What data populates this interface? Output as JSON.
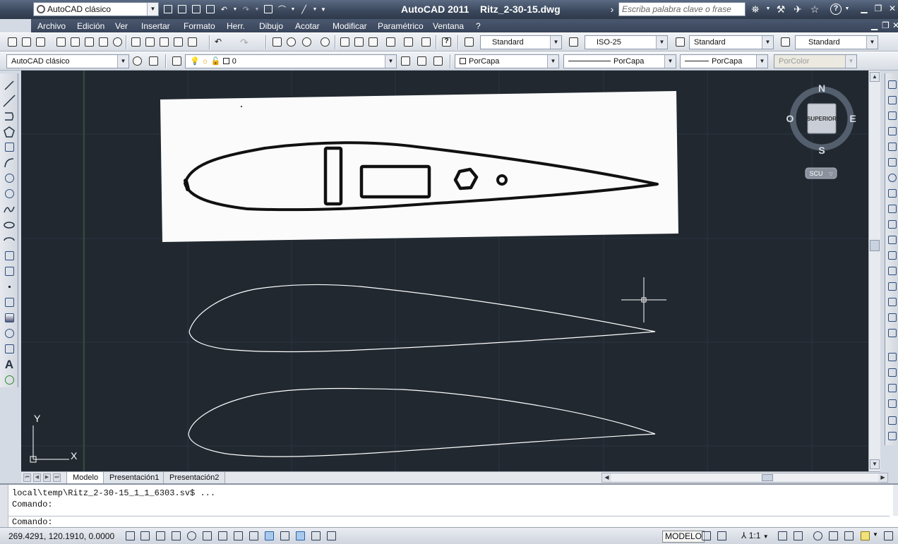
{
  "titlebar": {
    "app_title": "AutoCAD 2011",
    "file_name": "Ritz_2-30-15.dwg",
    "workspace": "AutoCAD clásico",
    "search_placeholder": "Escriba palabra clave o frase"
  },
  "menu": {
    "items": [
      "Archivo",
      "Edición",
      "Ver",
      "Insertar",
      "Formato",
      "Herr.",
      "Dibujo",
      "Acotar",
      "Modificar",
      "Paramétrico",
      "Ventana",
      "?"
    ]
  },
  "styles_toolbar": {
    "text_style": "Standard",
    "dim_style": "ISO-25",
    "table_style": "Standard",
    "mleader_style": "Standard"
  },
  "layers_toolbar": {
    "workspace": "AutoCAD clásico",
    "current_layer": "0"
  },
  "properties_toolbar": {
    "color": "PorCapa",
    "linetype": "PorCapa",
    "lineweight": "PorCapa",
    "plotstyle": "PorColor"
  },
  "viewcube": {
    "north": "N",
    "south": "S",
    "east": "E",
    "west": "O",
    "face": "SUPERIOR",
    "ucs": "SCU"
  },
  "ucs_icon": {
    "x_label": "X",
    "y_label": "Y"
  },
  "layout_tabs": {
    "items": [
      "Modelo",
      "Presentación1",
      "Presentación2"
    ],
    "active": "Modelo"
  },
  "command_line": {
    "history_line1": "local\\temp\\Ritz_2-30-15_1_1_6303.sv$ ...",
    "history_line2": "Comando:",
    "prompt": "Comando:"
  },
  "status_bar": {
    "coordinates": "269.4291, 120.1910, 0.0000",
    "space": "MODELO",
    "annotation_scale": "1:1"
  },
  "colors": {
    "canvas_bg": "#212830",
    "title_bar": "#3a475b",
    "grid_line": "#2c3541",
    "y_axis_line": "#2f6f3a",
    "drawing_lines": "#ffffff"
  }
}
